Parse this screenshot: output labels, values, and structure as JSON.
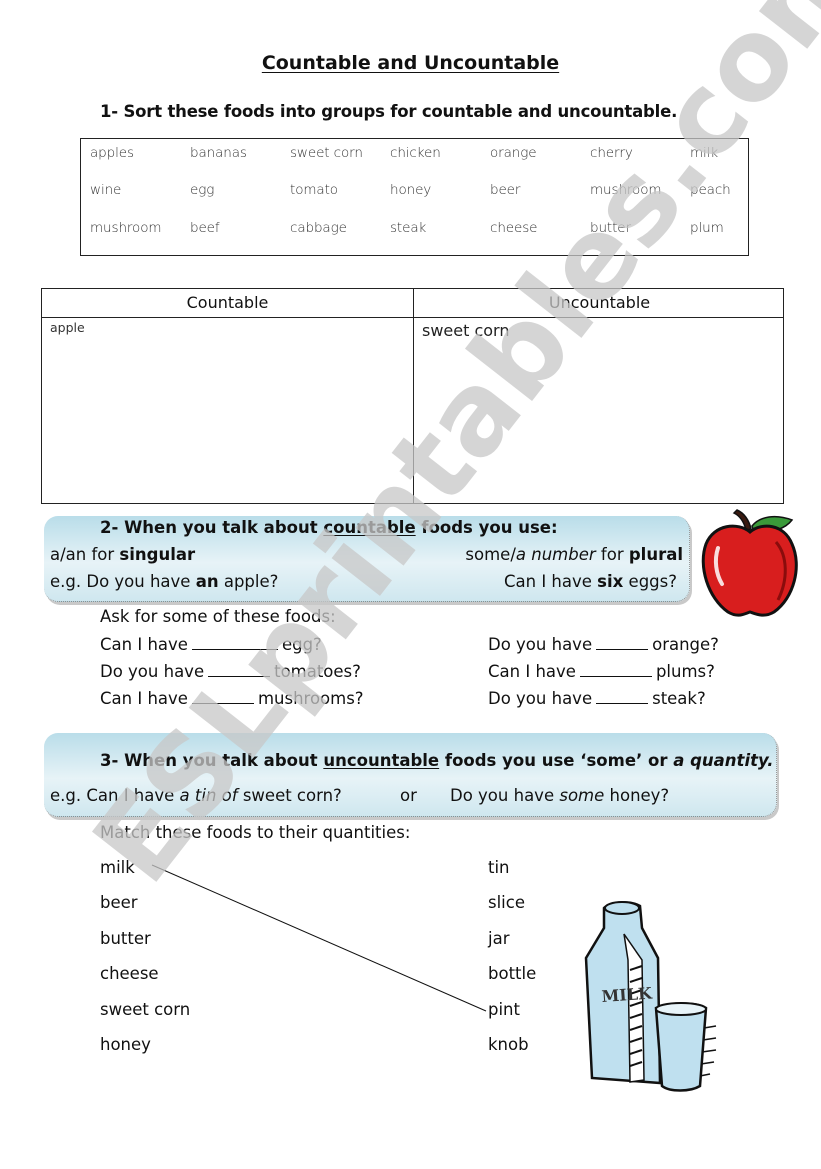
{
  "title": "Countable and Uncountable",
  "section1": {
    "instruction": "1- Sort these foods into groups for countable and uncountable.",
    "word_grid": [
      [
        "apples",
        "bananas",
        "sweet corn",
        "chicken",
        "orange",
        "cherry",
        "milk"
      ],
      [
        "wine",
        "egg",
        "tomato",
        "honey",
        "beer",
        "mushroom",
        "peach"
      ],
      [
        "mushroom",
        "beef",
        "cabbage",
        "steak",
        "cheese",
        "butter",
        "plum"
      ]
    ],
    "sort_table": {
      "headers": [
        "Countable",
        "Uncountable"
      ],
      "countable_entries": [
        "apple"
      ],
      "uncountable_entries": [
        "sweet corn"
      ]
    }
  },
  "section2": {
    "heading_prefix": "2- When you talk about ",
    "heading_keyword": "countable",
    "heading_suffix": " foods you use:",
    "singular_rule": {
      "pre": "a/an for ",
      "bold": "singular"
    },
    "plural_rule": {
      "pre": "some/",
      "italic": "a number",
      "mid": " for ",
      "bold": "plural"
    },
    "example_singular": {
      "pre": "e.g. Do you have ",
      "bold": "an",
      "post": " apple?"
    },
    "example_plural": {
      "pre": "Can I have ",
      "bold": "six",
      "post": " eggs?"
    },
    "exercise_prompt": "Ask for some of these foods:",
    "exercises_left": [
      {
        "pre": "Can I have",
        "post": "egg?"
      },
      {
        "pre": "Do you have",
        "post": "tomatoes?"
      },
      {
        "pre": "Can I have",
        "post": "mushrooms?"
      }
    ],
    "exercises_right": [
      {
        "pre": "Do you have",
        "post": "orange?"
      },
      {
        "pre": "Can I have",
        "post": "plums?"
      },
      {
        "pre": "Do you have",
        "post": "steak?"
      }
    ]
  },
  "section3": {
    "heading_prefix": "3- When you talk about ",
    "heading_keyword": "uncountable",
    "heading_mid": " foods you use ‘some’ or ",
    "heading_italic": "a quantity.",
    "example_1": {
      "pre": "e.g. Can I have ",
      "italic": "a tin of",
      "post": " sweet corn?"
    },
    "example_or": "or",
    "example_2": {
      "pre": "Do you have ",
      "italic": "some",
      "post": " honey?"
    },
    "match_prompt": "Match these foods to their quantities:",
    "foods": [
      "milk",
      "beer",
      "butter",
      "cheese",
      "sweet corn",
      "honey"
    ],
    "quantities": [
      "tin",
      "slice",
      "jar",
      "bottle",
      "pint",
      "knob"
    ],
    "drawn_match": {
      "food": "milk",
      "quantity": "pint"
    }
  },
  "watermark": "ESLprintables.com",
  "colors": {
    "callout_top": "#b9dde9",
    "callout_mid": "#e7f3f7",
    "apple_red": "#d81e1e",
    "leaf_green": "#3a9a3a",
    "milk_blue": "#bfe0ef",
    "watermark_gray": "#c8c8c8"
  }
}
